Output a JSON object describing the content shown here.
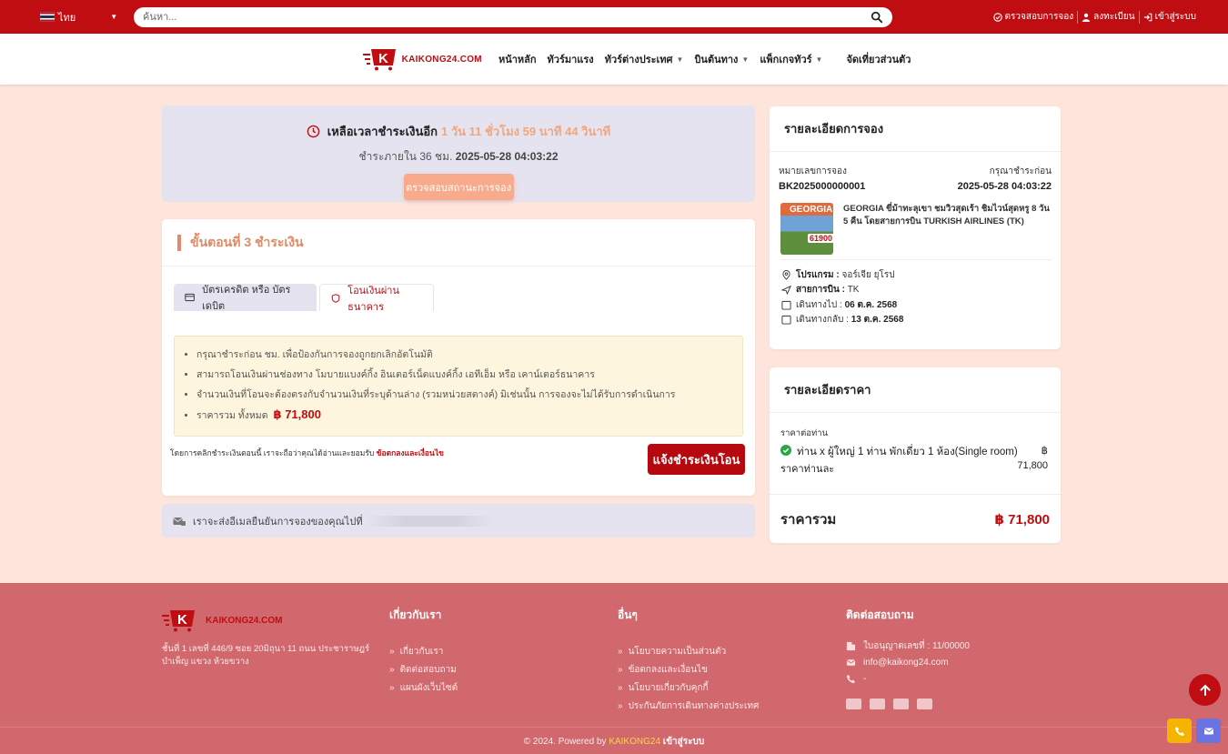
{
  "topbar": {
    "language": "ไทย",
    "search_placeholder": "ค้นหา...",
    "links": {
      "check_booking": "ตรวจสอบการจอง",
      "register": "ลงทะเบียน",
      "login": "เข้าสู่ระบบ"
    }
  },
  "header": {
    "brand": "KAIKONG24.COM",
    "nav": [
      "หน้าหลัก",
      "ทัวร์มาแรง",
      "ทัวร์ต่างประเทศ",
      "บินต้นทาง",
      "แพ็กเกจทัวร์",
      "จัดเที่ยวส่วนตัว"
    ]
  },
  "countdown": {
    "label": "เหลือเวลาชำระเงินอีก",
    "time_left": "1 วัน 11 ชั่วโมง 59 นาที 44 วินาที",
    "deadline_prefix": "ชำระภายใน 36 ชม.",
    "deadline": "2025-05-28 04:03:22",
    "check_button": "ตรวจสอบสถานะการจอง"
  },
  "step": {
    "title": "ขั้นตอนที่ 3 ชำระเงิน",
    "tabs": {
      "card": "บัตรเครดิต หรือ บัตรเดบิต",
      "bank": "โอนเงินผ่านธนาคาร"
    },
    "notices": [
      "กรุณาชำระก่อน ชม. เพื่อป้องกันการจองถูกยกเลิกอัตโนมัติ",
      "สามารถโอนเงินผ่านช่องทาง โมบายแบงค์กิ้ง อินเตอร์เน็ตแบงค์กิ้ง เอทีเอ็ม หรือ เคาน์เตอร์ธนาคาร",
      "จำนวนเงินที่โอนจะต้องตรงกับจำนวนเงินที่ระบุด้านล่าง (รวมหน่วยสตางค์) มิเช่นนั้น การจองจะไม่ได้รับการดำเนินการ"
    ],
    "total_label": "ราคารวม ทั้งหมด",
    "total_price": "฿ 71,800",
    "terms_text": "โดยการคลิกชำระเงินตอนนี้ เราจะถือว่าคุณได้อ่านและยอมรับ",
    "terms_link": "ข้อตกลงและเงื่อนไข",
    "notify_button": "แจ้งชำระเงินโอน"
  },
  "email_notice": "เราจะส่งอีเมลยืนยันการจองของคุณไปที่",
  "booking": {
    "title": "รายละเอียดการจอง",
    "booking_no_label": "หมายเลขการจอง",
    "booking_no": "BK2025000000001",
    "pay_before_label": "กรุณาชำระก่อน",
    "pay_before": "2025-05-28 04:03:22",
    "thumb_title": "GEORGIA",
    "thumb_price": "61900",
    "tour_title": "GEORGIA ขี่ม้าทะลุเขา ชมวิวสุดเร้า ชิมไวน์สุดหรู 8 วัน 5 คืน โดยสายการบิน TURKISH AIRLINES (TK)",
    "program_label": "โปรแกรม :",
    "program": "จอร์เจีย ยุโรป",
    "airline_label": "สายการบิน :",
    "airline": "TK",
    "depart_label": "เดินทางไป :",
    "depart": "06 ต.ค. 2568",
    "return_label": "เดินทางกลับ :",
    "return": "13 ต.ค. 2568"
  },
  "price": {
    "title": "รายละเอียดราคา",
    "per_person_label": "ราคาต่อท่าน",
    "line_item": "ท่าน x  ผู้ใหญ่ 1 ท่าน พักเดี่ยว 1 ห้อง(Single room)",
    "currency": "฿",
    "per_unit_label": "ราคาท่านละ",
    "per_unit_price": "71,800",
    "total_label": "ราคารวม",
    "total": "฿ 71,800"
  },
  "footer": {
    "brand": "KAIKONG24.COM",
    "address": "ชั้นที่ 1 เลขที่ 446/9 ซอย 20มิถุนา 11 ถนน ประชาราษฎร์บำเพ็ญ แขวง ห้วยขวาง",
    "about_title": "เกี่ยวกับเรา",
    "about_links": [
      "เกี่ยวกับเรา",
      "ติดต่อสอบถาม",
      "แผนผังเว็บไซต์"
    ],
    "other_title": "อื่นๆ",
    "other_links": [
      "นโยบายความเป็นส่วนตัว",
      "ข้อตกลงและเงื่อนไข",
      "นโยบายเกี่ยวกับคุกกี้",
      "ประกันภัยการเดินทางต่างประเทศ"
    ],
    "contact_title": "ติดต่อสอบถาม",
    "license": "ใบอนุญาตเลขที่ : 11/00000",
    "email": "info@kaikong24.com",
    "phone": "-",
    "copyright": "© 2024. Powered by",
    "copyright_brand": "KAIKONG24",
    "copyright_login": "เข้าสู่ระบบ"
  },
  "colors": {
    "brand_red": "#c00d12",
    "accent_orange": "#f3a67a",
    "footer_bg": "#d0686d",
    "page_bg": "#fde5dc"
  }
}
